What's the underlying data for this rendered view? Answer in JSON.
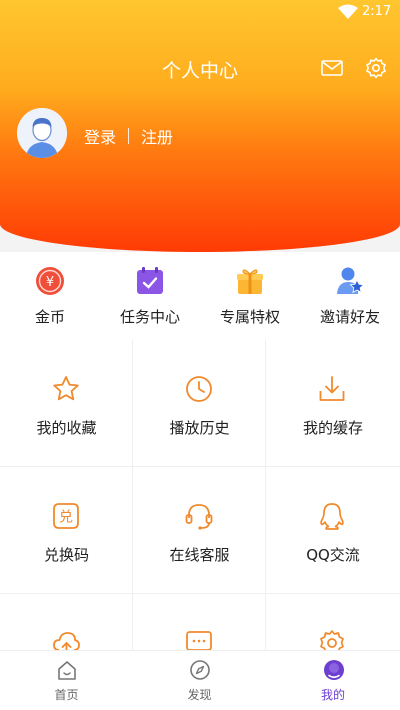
{
  "status_bar": {
    "time": "2:17"
  },
  "header": {
    "title": "个人中心",
    "login_label": "登录",
    "register_label": "注册"
  },
  "quick_actions": [
    {
      "label": "金币",
      "icon": "coin-icon"
    },
    {
      "label": "任务中心",
      "icon": "calendar-check-icon"
    },
    {
      "label": "专属特权",
      "icon": "gift-icon"
    },
    {
      "label": "邀请好友",
      "icon": "invite-user-icon"
    }
  ],
  "features": [
    {
      "label": "我的收藏",
      "icon": "star-icon"
    },
    {
      "label": "播放历史",
      "icon": "clock-icon"
    },
    {
      "label": "我的缓存",
      "icon": "download-icon"
    },
    {
      "label": "兑换码",
      "icon": "redeem-icon"
    },
    {
      "label": "在线客服",
      "icon": "headset-icon"
    },
    {
      "label": "QQ交流",
      "icon": "qq-icon"
    },
    {
      "label": "",
      "icon": "cloud-upload-icon"
    },
    {
      "label": "",
      "icon": "chat-icon"
    },
    {
      "label": "",
      "icon": "settings-icon"
    }
  ],
  "tabbar": [
    {
      "label": "首页",
      "icon": "home-icon"
    },
    {
      "label": "发现",
      "icon": "compass-icon"
    },
    {
      "label": "我的",
      "icon": "profile-icon",
      "active": true
    }
  ],
  "colors": {
    "accent_orange": "#f08a2c",
    "active_tab": "#6c3fd0",
    "header_top": "#ffc62f",
    "header_bottom": "#ff3b05"
  }
}
